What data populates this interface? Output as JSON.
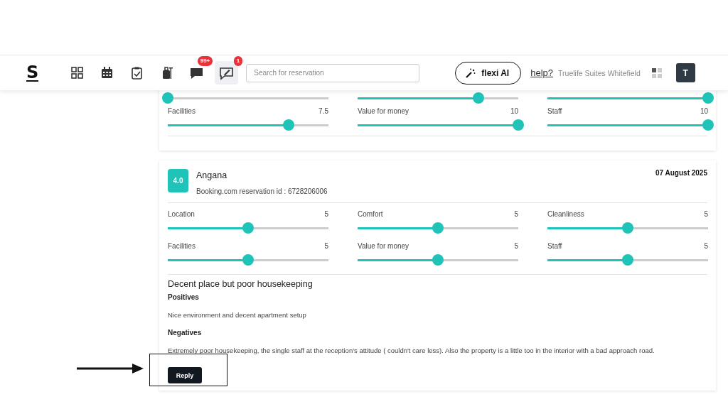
{
  "header": {
    "logo": "S",
    "nav": [
      {
        "kind": "grid",
        "selected": false
      },
      {
        "kind": "calendar",
        "selected": false
      },
      {
        "kind": "clipboard",
        "selected": false
      },
      {
        "kind": "luggage",
        "selected": false
      },
      {
        "kind": "chat",
        "badge": "99+",
        "selected": false
      },
      {
        "kind": "compose",
        "badge": "1",
        "selected": true
      }
    ],
    "search": {
      "placeholder": "Search for reservation"
    },
    "ai_button": "flexi AI",
    "help": "help?",
    "property": "Truelife Suites Whitefield",
    "avatar": "T"
  },
  "previous_review": {
    "ratings": [
      {
        "level": 0
      },
      {
        "level": 0.75
      },
      {
        "level": 1
      },
      {
        "label": "Facilities",
        "score": "7.5",
        "level": 0.75
      },
      {
        "label": "Value for money",
        "score": "10",
        "level": 1
      },
      {
        "label": "Staff",
        "score": "10",
        "level": 1
      }
    ]
  },
  "review": {
    "score": "4.0",
    "guest": "Angana",
    "reservation": "Booking.com reservation id : 6728206006",
    "date": "07 August 2025",
    "ratings": [
      {
        "label": "Location",
        "score": "5",
        "level": 0.5
      },
      {
        "label": "Comfort",
        "score": "5",
        "level": 0.5
      },
      {
        "label": "Cleanliness",
        "score": "5",
        "level": 0.5
      },
      {
        "label": "Facilities",
        "score": "5",
        "level": 0.5
      },
      {
        "label": "Value for money",
        "score": "5",
        "level": 0.5
      },
      {
        "label": "Staff",
        "score": "5",
        "level": 0.5
      }
    ],
    "title": "Decent place but poor housekeeping",
    "positives_heading": "Positives",
    "positives": "Nice environment and decent apartment setup",
    "negatives_heading": "Negatives",
    "negatives": "Extremely poor housekeeping, the single staff at the reception's attitude ( couldn't care less). Also the property is a little too in the interior with a bad approach road.",
    "reply_button": "Reply"
  }
}
